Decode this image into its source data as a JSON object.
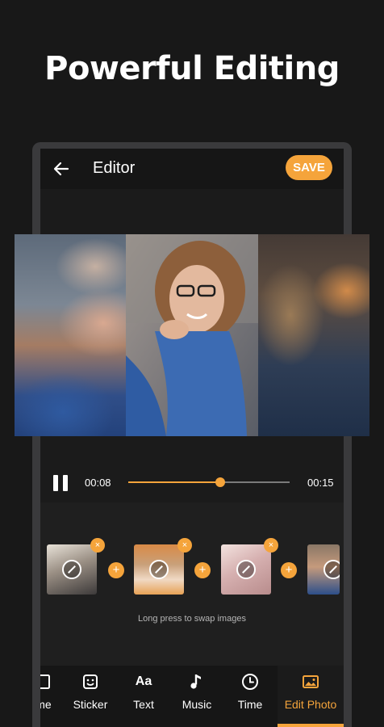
{
  "headline": "Powerful Editing",
  "appbar": {
    "title": "Editor",
    "save_label": "SAVE"
  },
  "player": {
    "current_time": "00:08",
    "total_time": "00:15",
    "progress": 0.57
  },
  "clips": [
    {
      "name": "clip-1"
    },
    {
      "name": "clip-2"
    },
    {
      "name": "clip-3"
    },
    {
      "name": "clip-4"
    }
  ],
  "clip_remove_glyph": "×",
  "clip_add_glyph": "+",
  "hint": "Long press to swap images",
  "toolbar": {
    "items": [
      {
        "label": "me",
        "icon": "frame-icon"
      },
      {
        "label": "Sticker",
        "icon": "sticker-icon"
      },
      {
        "label": "Text",
        "icon": "text-icon"
      },
      {
        "label": "Music",
        "icon": "music-note-icon"
      },
      {
        "label": "Time",
        "icon": "clock-icon"
      },
      {
        "label": "Edit Photo",
        "icon": "image-icon"
      }
    ],
    "text_icon_glyph": "Aa",
    "active_index": 5
  },
  "colors": {
    "accent": "#f5a43b",
    "background": "#181818",
    "surface": "#1f1f1f"
  }
}
